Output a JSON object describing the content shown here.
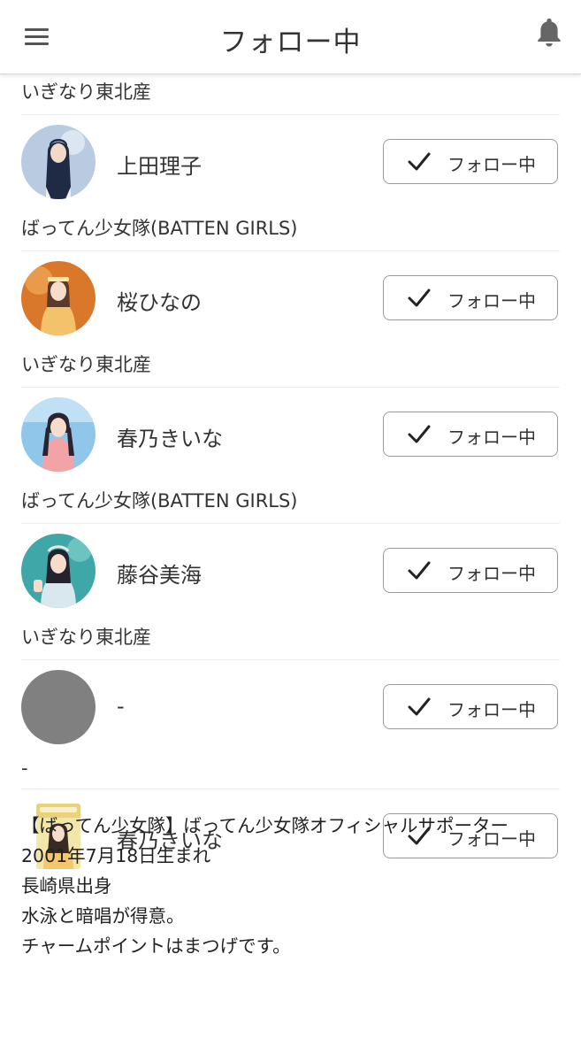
{
  "header": {
    "title": "フォロー中",
    "menu_icon": "hamburger-menu-icon",
    "bell_icon": "bell-icon"
  },
  "top_group": "いぎなり東北産",
  "follow_label": "フォロー中",
  "items": [
    {
      "name": "上田理子",
      "group": "ばってん少女隊(BATTEN GIRLS)",
      "avatar": "photo",
      "bg": "#b7c9df"
    },
    {
      "name": "桜ひなの",
      "group": "いぎなり東北産",
      "avatar": "photo",
      "bg": "#d9782a"
    },
    {
      "name": "春乃きいな",
      "group": "ばってん少女隊(BATTEN GIRLS)",
      "avatar": "photo",
      "bg": "#8fc6ea"
    },
    {
      "name": "藤谷美海",
      "group": "いぎなり東北産",
      "avatar": "photo",
      "bg": "#3fa7a8"
    },
    {
      "name": "-",
      "group": "-",
      "avatar": "placeholder",
      "bg": "#808080"
    },
    {
      "name": "春乃きいな",
      "group": "",
      "avatar": "card",
      "bg": "#e9d27a"
    }
  ],
  "bio_lines": [
    "【ばってん少女隊】ばってん少女隊オフィシャルサポーター",
    "2001年7月18日生まれ",
    "長崎県出身",
    "水泳と暗唱が得意。",
    "チャームポイントはまつげです。"
  ],
  "colors": {
    "text": "#333333",
    "button_border": "#9a9a9a",
    "divider": "#ececec",
    "placeholder_avatar": "#808080"
  }
}
